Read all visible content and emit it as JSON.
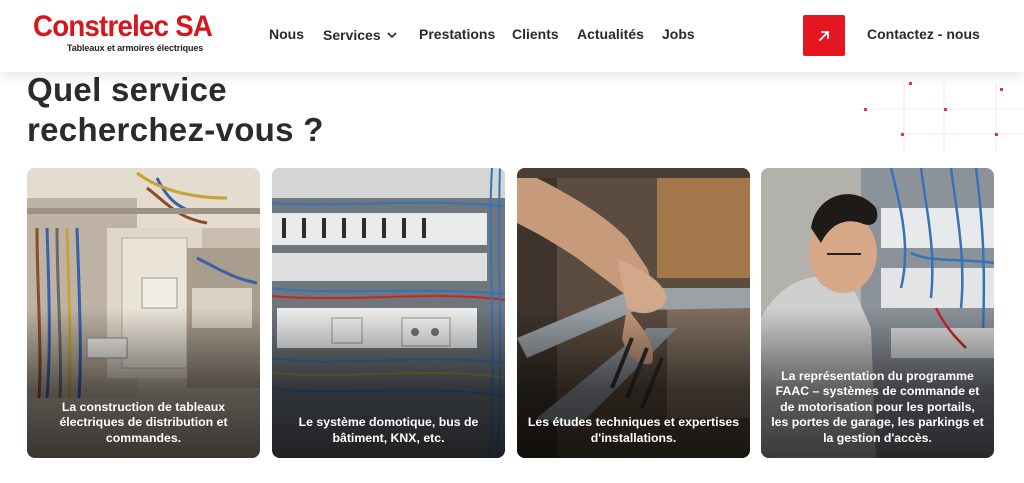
{
  "brand": {
    "name": "Constrelec SA",
    "tagline": "Tableaux et armoires électriques",
    "color": "#d8141c"
  },
  "nav": {
    "items": [
      {
        "label": "Nous"
      },
      {
        "label": "Services",
        "has_dropdown": true
      },
      {
        "label": "Prestations"
      },
      {
        "label": "Clients"
      },
      {
        "label": "Actualités"
      },
      {
        "label": "Jobs"
      }
    ],
    "cta_icon": "arrow-up-right-icon",
    "cta_color": "#e4161f",
    "contact_label": "Contactez - nous"
  },
  "section": {
    "title_line1": "Quel service",
    "title_line2": "recherchez-vous ?"
  },
  "cards": [
    {
      "caption": "La construction de tableaux électriques de distribution et commandes.",
      "image": "electrical-cabinet-construction-photo"
    },
    {
      "caption": "Le système domotique, bus de bâtiment, KNX, etc.",
      "image": "wired-control-panel-photo"
    },
    {
      "caption": "Les études techniques et expertises d'installations.",
      "image": "hands-working-on-rail-photo"
    },
    {
      "caption": "La représentation du programme FAAC – systèmes de commande et de motorisation pour les portails, les portes de garage, les parkings et la gestion d'accès.",
      "image": "technician-at-panel-photo"
    }
  ]
}
